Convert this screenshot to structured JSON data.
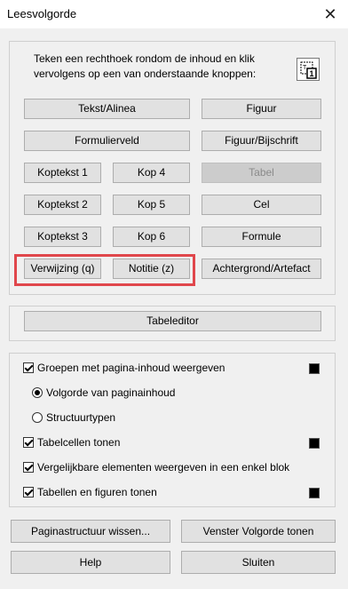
{
  "window": {
    "title": "Leesvolgorde",
    "close_glyph": "✕"
  },
  "instructions": "Teken een rechthoek rondom de inhoud en klik vervolgens op een van onderstaande knoppen:",
  "tool_icon": "draw-rectangle-icon",
  "buttons": {
    "tekst_alinea": "Tekst/Alinea",
    "figuur": "Figuur",
    "formulierveld": "Formulierveld",
    "figuur_bijschrift": "Figuur/Bijschrift",
    "koptekst1": "Koptekst 1",
    "kop4": "Kop 4",
    "tabel": "Tabel",
    "koptekst2": "Koptekst 2",
    "kop5": "Kop 5",
    "cel": "Cel",
    "koptekst3": "Koptekst 3",
    "kop6": "Kop 6",
    "formule": "Formule",
    "verwijzing": "Verwijzing (q)",
    "notitie": "Notitie (z)",
    "achtergrond": "Achtergrond/Artefact",
    "tabeleditor": "Tabeleditor",
    "paginastructuur_wissen": "Paginastructuur wissen...",
    "venster_volgorde": "Venster Volgorde tonen",
    "help": "Help",
    "sluiten": "Sluiten"
  },
  "options": {
    "groepen": {
      "label": "Groepen met pagina-inhoud weergeven",
      "checked": true
    },
    "volgorde": {
      "label": "Volgorde van paginainhoud",
      "selected": true
    },
    "structuurtypen": {
      "label": "Structuurtypen",
      "selected": false
    },
    "tabelcellen": {
      "label": "Tabelcellen tonen",
      "checked": true
    },
    "vergelijkbare": {
      "label": "Vergelijkbare elementen weergeven in een enkel blok",
      "checked": true
    },
    "tabellen_figuren": {
      "label": "Tabellen en figuren tonen",
      "checked": true
    }
  },
  "colors": {
    "highlight": "#e0474c",
    "swatch": "#000000"
  }
}
